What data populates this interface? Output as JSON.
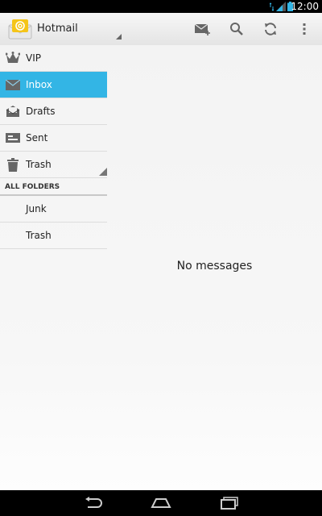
{
  "status_bar": {
    "time": "12:00",
    "icons": [
      "data-arrows-icon",
      "signal-icon",
      "battery-icon"
    ]
  },
  "action_bar": {
    "account_name": "Hotmail",
    "actions": [
      "compose-icon",
      "search-icon",
      "refresh-icon",
      "overflow-menu-icon"
    ]
  },
  "sidebar": {
    "items": [
      {
        "label": "VIP",
        "icon": "crown-icon",
        "active": false
      },
      {
        "label": "Inbox",
        "icon": "envelope-icon",
        "active": true
      },
      {
        "label": "Drafts",
        "icon": "drafts-icon",
        "active": false
      },
      {
        "label": "Sent",
        "icon": "sent-icon",
        "active": false
      },
      {
        "label": "Trash",
        "icon": "trash-icon",
        "active": false
      }
    ],
    "section_title": "ALL FOLDERS",
    "folders": [
      {
        "label": "Junk"
      },
      {
        "label": "Trash"
      }
    ]
  },
  "content": {
    "empty_message": "No messages"
  },
  "colors": {
    "active_item": "#33b5e5",
    "status_bar": "#000000",
    "nav_bar": "#000000"
  },
  "nav_bar": {
    "buttons": [
      "back-icon",
      "home-icon",
      "recent-apps-icon"
    ]
  }
}
